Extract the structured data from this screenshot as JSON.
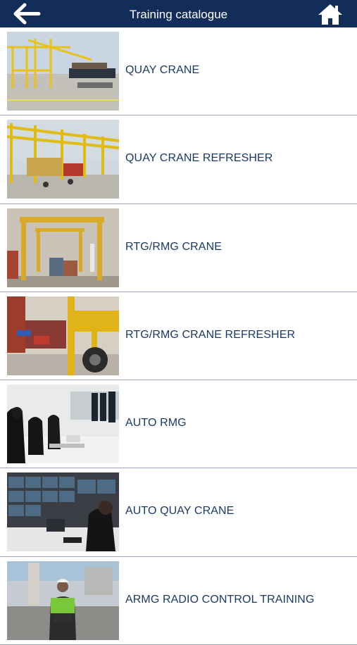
{
  "header": {
    "title": "Training catalogue",
    "back_icon": "arrow-left-icon",
    "home_icon": "home-icon",
    "bg_color": "#112d58"
  },
  "courses": [
    {
      "label": "QUAY CRANE",
      "image": "quay-crane-photo"
    },
    {
      "label": "QUAY CRANE REFRESHER",
      "image": "quay-crane-refresher-photo"
    },
    {
      "label": "RTG/RMG CRANE",
      "image": "rtg-rmg-crane-photo"
    },
    {
      "label": "RTG/RMG CRANE REFRESHER",
      "image": "rtg-rmg-refresher-photo"
    },
    {
      "label": "AUTO RMG",
      "image": "auto-rmg-control-room-photo"
    },
    {
      "label": "AUTO QUAY CRANE",
      "image": "auto-quay-crane-control-room-photo"
    },
    {
      "label": "ARMG RADIO CONTROL TRAINING",
      "image": "armg-radio-control-photo"
    }
  ]
}
